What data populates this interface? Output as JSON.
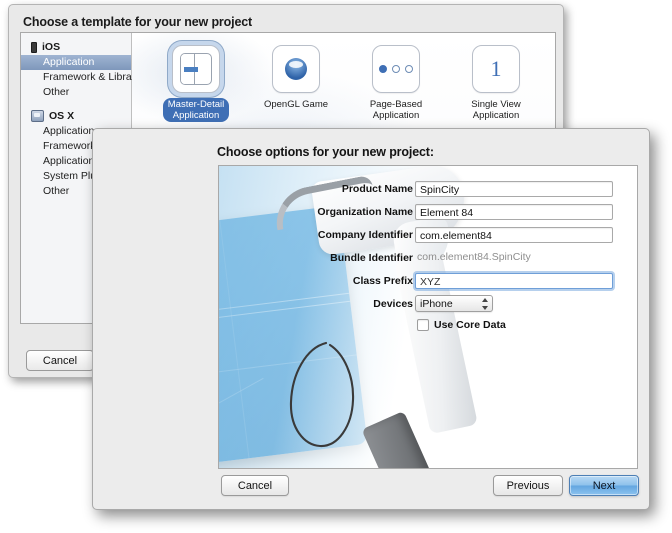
{
  "back_window": {
    "title": "Choose a template for your new project",
    "cancel_label": "Cancel",
    "sidebar": {
      "groups": [
        {
          "name": "iOS",
          "icon": "iphone-icon",
          "items": [
            "Application",
            "Framework & Library",
            "Other"
          ],
          "selected": "Application"
        },
        {
          "name": "OS X",
          "icon": "osx-icon",
          "items": [
            "Application",
            "Framework",
            "Application",
            "System Plu",
            "Other"
          ],
          "selected": ""
        }
      ]
    },
    "templates": [
      {
        "label": "Master-Detail\nApplication",
        "line1": "Master-Detail",
        "line2": "Application",
        "icon": "master-detail-icon",
        "selected": true
      },
      {
        "label": "OpenGL Game",
        "line1": "OpenGL Game",
        "line2": "",
        "icon": "opengl-sphere-icon",
        "selected": false
      },
      {
        "label": "Page-Based Application",
        "line1": "Page-Based",
        "line2": "Application",
        "icon": "page-dots-icon",
        "selected": false
      },
      {
        "label": "Single View Application",
        "line1": "Single View",
        "line2": "Application",
        "icon": "number-one-icon",
        "selected": false
      }
    ]
  },
  "front_window": {
    "title": "Choose options for your new project:",
    "fields": [
      {
        "label": "Product Name",
        "value": "SpinCity",
        "type": "text",
        "focused": false
      },
      {
        "label": "Organization Name",
        "value": "Element 84",
        "type": "text",
        "focused": false
      },
      {
        "label": "Company Identifier",
        "value": "com.element84",
        "type": "text",
        "focused": false
      },
      {
        "label": "Bundle Identifier",
        "value": "com.element84.SpinCity",
        "type": "static",
        "focused": false
      },
      {
        "label": "Class Prefix",
        "value": "XYZ",
        "type": "text",
        "focused": true
      }
    ],
    "devices": {
      "label": "Devices",
      "value": "iPhone"
    },
    "core_data": {
      "label": "Use Core Data",
      "checked": false
    },
    "buttons": {
      "cancel": "Cancel",
      "previous": "Previous",
      "next": "Next"
    }
  },
  "colors": {
    "accent_blue": "#3f6fb5",
    "selection_blue": "#7e97bb",
    "focus_ring": "#6f9fd8",
    "blueprint": "#63afe0",
    "window_chrome": "#ececec"
  },
  "annotation": {
    "type": "hand-drawn-ellipse",
    "target": "devices-popup"
  }
}
